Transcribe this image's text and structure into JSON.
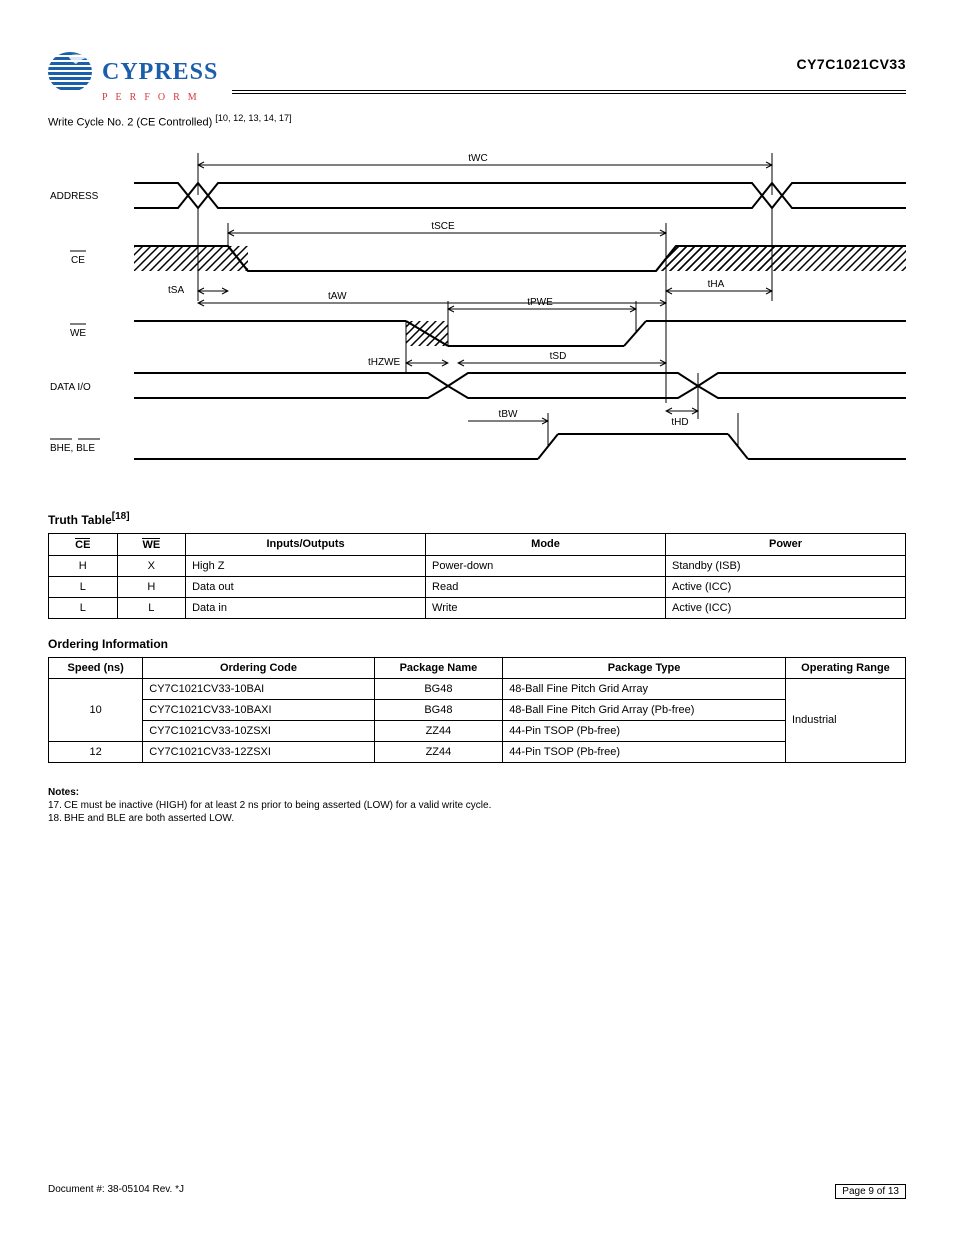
{
  "part_number": "CY7C1021CV33",
  "diagram": {
    "title_prefix": "Write Cycle No. 2 (CE Controlled)",
    "title_refs": "[10, 12, 13, 14, 17]",
    "signals": {
      "address": "ADDRESS",
      "ce": "CE",
      "we": "WE",
      "data": "DATA I/O",
      "bhe_ble": "BHE, BLE"
    },
    "labels": {
      "twc": "tWC",
      "tsce": "tSCE",
      "tsa": "tSA",
      "taw": "tAW",
      "tha": "tHA",
      "tpwe": "tPWE",
      "thzwe": "tHZWE",
      "tsd": "tSD",
      "thd": "tHD",
      "tbw": "tBW"
    }
  },
  "truth": {
    "title": "Truth Table",
    "headers": [
      "CE",
      "WE",
      "Inputs/Outputs",
      "Mode",
      "Power"
    ],
    "rows": [
      [
        "H",
        "X",
        "High Z",
        "Power-down",
        "Standby (ISB)"
      ],
      [
        "L",
        "H",
        "Data out",
        "Read",
        "Active (ICC)"
      ],
      [
        "L",
        "L",
        "Data in",
        "Write",
        "Active (ICC)"
      ]
    ],
    "footnote_ref": "[18]"
  },
  "ordering": {
    "title": "Ordering Information",
    "headers": [
      "Speed (ns)",
      "Ordering Code",
      "Package Name",
      "Package Type",
      "Operating Range"
    ],
    "rows": [
      {
        "speed": "10",
        "code": "CY7C1021CV33-10BAI",
        "pkg_name": "BG48",
        "pkg_type": "48-Ball Fine Pitch Grid Array",
        "range": "Industrial"
      },
      {
        "speed": "10",
        "code": "CY7C1021CV33-10BAXI",
        "pkg_name": "BG48",
        "pkg_type": "48-Ball Fine Pitch Grid Array (Pb-free)",
        "range": "Industrial"
      },
      {
        "speed": "10",
        "code": "CY7C1021CV33-10ZSXI",
        "pkg_name": "ZZ44",
        "pkg_type": "44-Pin TSOP (Pb-free)",
        "range": "Industrial"
      },
      {
        "speed": "12",
        "code": "CY7C1021CV33-12ZSXI",
        "pkg_name": "ZZ44",
        "pkg_type": "44-Pin TSOP (Pb-free)",
        "range": "Industrial"
      }
    ]
  },
  "footnotes": {
    "header": "Notes:",
    "items": [
      {
        "num": "17.",
        "text": "CE must be inactive (HIGH) for at least 2 ns prior to being asserted (LOW) for a valid write cycle."
      },
      {
        "num": "18.",
        "text": "BHE and BLE are both asserted LOW."
      }
    ]
  },
  "footer": {
    "doc": "Document #: 38-05104 Rev. *J",
    "page_label": "Page 9 of 13"
  }
}
